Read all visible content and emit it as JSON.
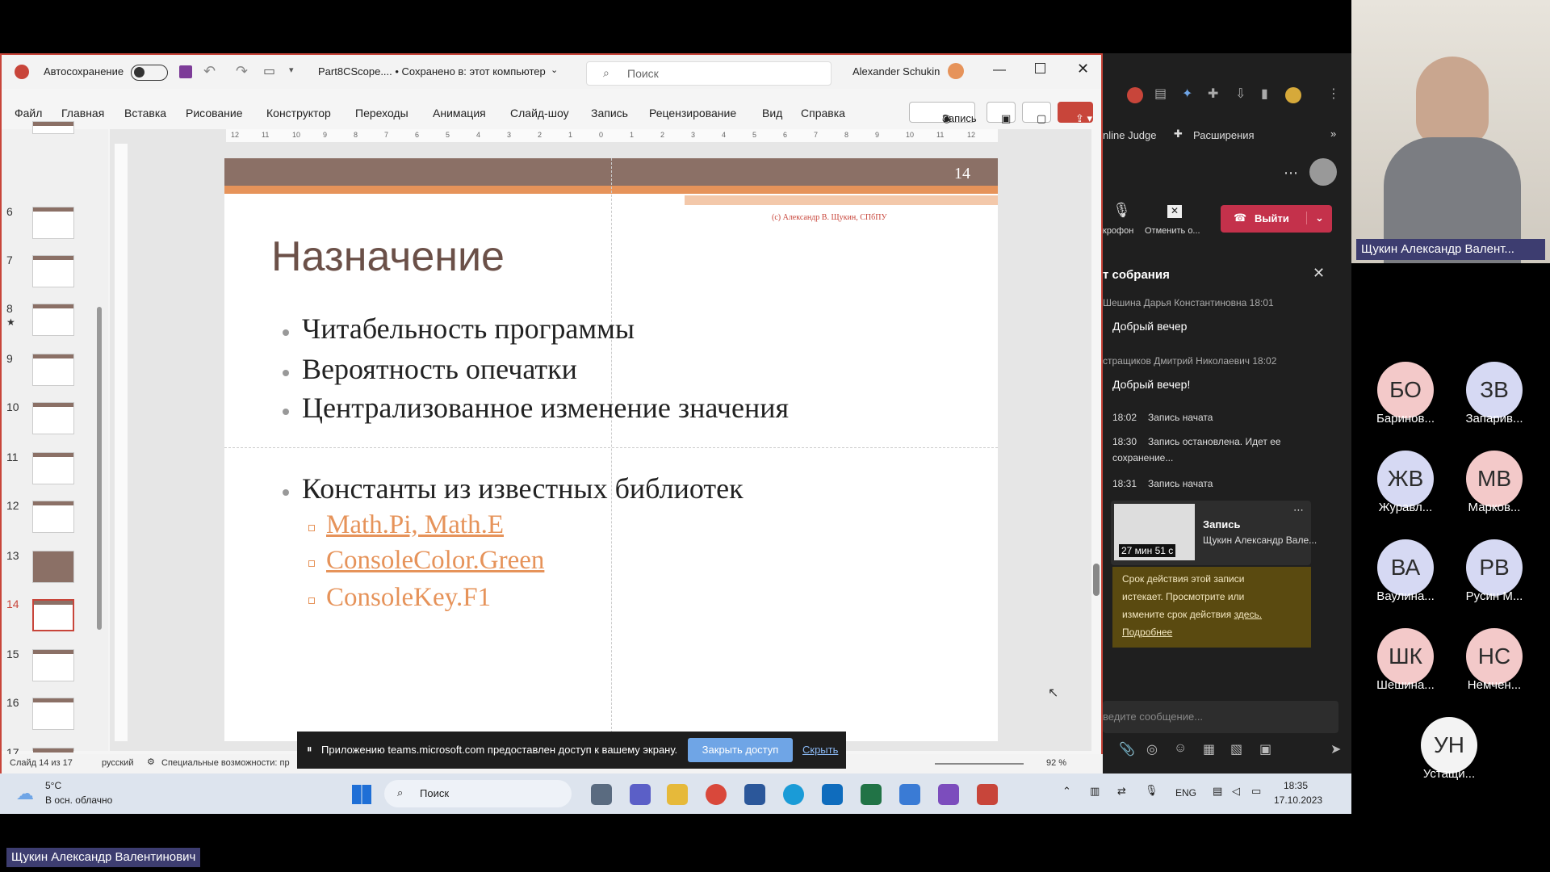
{
  "ppt": {
    "autosave_label": "Автосохранение",
    "filename": "Part8CScope.... • Сохранено в: этот компьютер",
    "search_placeholder": "Поиск",
    "user": "Alexander Schukin",
    "menu": [
      "Файл",
      "Главная",
      "Вставка",
      "Рисование",
      "Конструктор",
      "Переходы",
      "Анимация",
      "Слайд-шоу",
      "Запись",
      "Рецензирование",
      "Вид",
      "Справка"
    ],
    "record_button": "Запись",
    "thumbnails": [
      "6",
      "7",
      "8",
      "9",
      "10",
      "11",
      "12",
      "13",
      "14",
      "15",
      "16",
      "17"
    ],
    "active_slide": "14",
    "ruler_h": [
      "12",
      "11",
      "10",
      "9",
      "8",
      "7",
      "6",
      "5",
      "4",
      "3",
      "2",
      "1",
      "0",
      "1",
      "2",
      "3",
      "4",
      "5",
      "6",
      "7",
      "8",
      "9",
      "10",
      "11",
      "12"
    ],
    "slide": {
      "number": "14",
      "copyright": "(c) Александр В. Щукин, СПбПУ",
      "title": "Назначение",
      "bullets": [
        "Читабельность программы",
        "Вероятность опечатки",
        "Централизованное изменение значения",
        "Константы из известных библиотек"
      ],
      "subbullets": [
        "Math.Pi, Math.E",
        "ConsoleColor.Green",
        "ConsoleKey.F1"
      ]
    },
    "status": {
      "slide": "Слайд 14 из 17",
      "lang": "русский",
      "accessibility": "Специальные возможности: пр",
      "zoom": "92 %"
    },
    "share": {
      "message": "Приложению teams.microsoft.com предоставлен доступ к вашему экрану.",
      "stop": "Закрыть доступ",
      "hide": "Скрыть"
    }
  },
  "teams": {
    "bookmarks": [
      "nline Judge",
      "Расширения"
    ],
    "mic": "крофон",
    "cancel": "Отменить о...",
    "leave": "Выйти",
    "chat_title": "т собрания",
    "messages": [
      {
        "author": "Шешина Дарья Константиновна  18:01",
        "text": "Добрый вечер"
      },
      {
        "author": "стращиков Дмитрий Николаевич  18:02",
        "text": "Добрый вечер!"
      }
    ],
    "events": [
      {
        "time": "18:02",
        "text": "Запись начата"
      },
      {
        "time": "18:30",
        "text": "Запись остановлена. Идет ее"
      },
      {
        "time": "",
        "text": "сохранение..."
      },
      {
        "time": "18:31",
        "text": "Запись начата"
      }
    ],
    "rec_title": "Запись",
    "rec_author": "Щукин Александр Вале...",
    "rec_duration": "27 мин 51 с",
    "notice": [
      "Срок действия этой записи",
      "истекает. Просмотрите или",
      "измените срок действия",
      "Подробнее"
    ],
    "notice_link": "здесь.",
    "compose_placeholder": "ведите сообщение..."
  },
  "taskbar": {
    "weather_temp": "5°C",
    "weather_desc": "В осн. облачно",
    "search": "Поиск",
    "lang": "ENG",
    "time": "18:35",
    "date": "17.10.2023"
  },
  "participants": [
    {
      "initials": "БО",
      "name": "Баринов...",
      "color": "#f3c9c9"
    },
    {
      "initials": "ЗВ",
      "name": "Запарив...",
      "color": "#d6d9f3"
    },
    {
      "initials": "ЖВ",
      "name": "Журавл...",
      "color": "#d6d9f3"
    },
    {
      "initials": "МВ",
      "name": "Марков...",
      "color": "#f3c9c9"
    },
    {
      "initials": "ВА",
      "name": "Ваулина...",
      "color": "#d6d9f3"
    },
    {
      "initials": "РВ",
      "name": "Русин М...",
      "color": "#d6d9f3"
    },
    {
      "initials": "ШК",
      "name": "Шешина...",
      "color": "#f3c9c9"
    },
    {
      "initials": "НС",
      "name": "Немчен...",
      "color": "#f3c9c9"
    },
    {
      "initials": "УН",
      "name": "Устащи...",
      "color": "#f3f3f3"
    }
  ],
  "presenter_label": "Щукин Александр Валент...",
  "bottom_label": "Щукин Александр Валентинович"
}
